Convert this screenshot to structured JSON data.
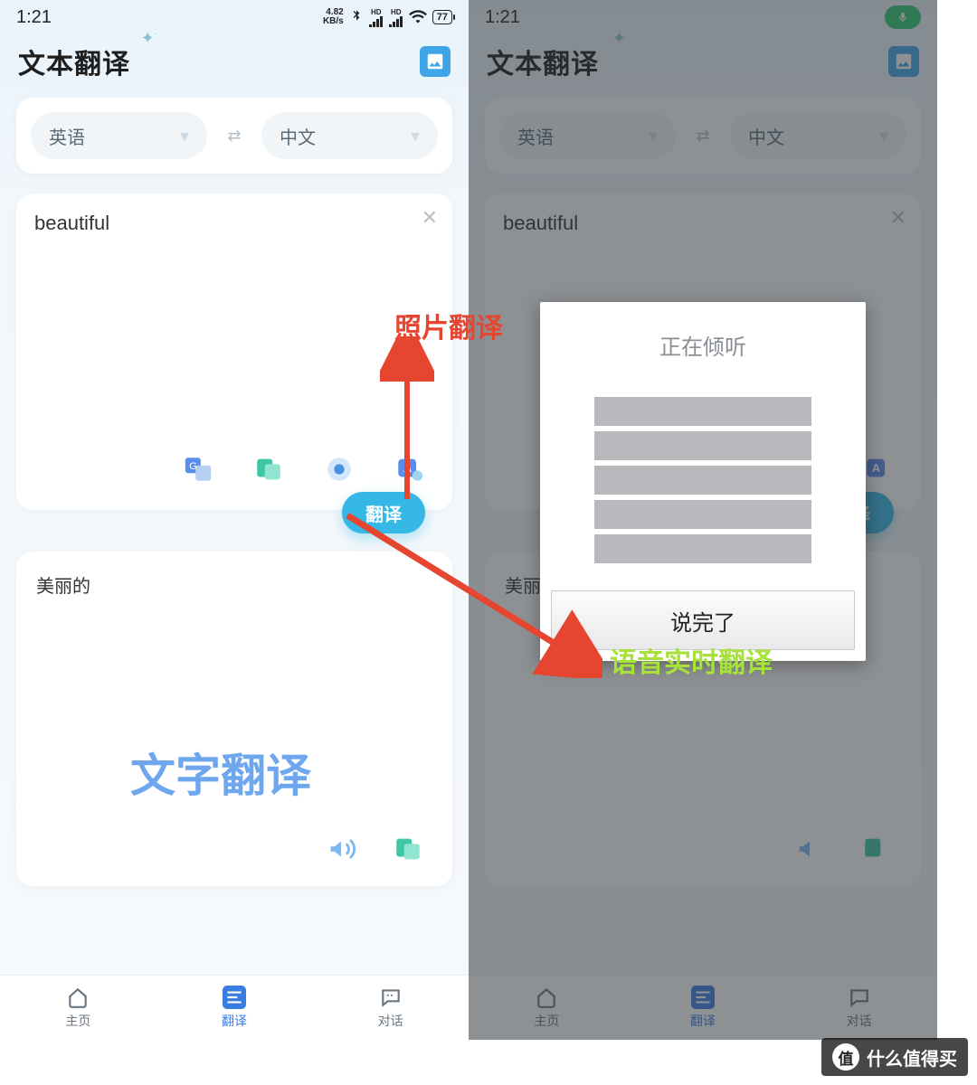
{
  "status": {
    "time": "1:21",
    "speed_value": "4.82",
    "speed_unit": "KB/s",
    "hd": "HD",
    "battery": "77"
  },
  "header": {
    "title": "文本翻译"
  },
  "langs": {
    "source": "英语",
    "target": "中文"
  },
  "input": {
    "text": "beautiful"
  },
  "translate_button": "翻译",
  "result": {
    "text": "美丽的"
  },
  "tabs": {
    "home": "主页",
    "translate": "翻译",
    "dialog": "对话"
  },
  "annotations": {
    "photo": "照片翻译",
    "text": "文字翻译",
    "voice": "语音实时翻译"
  },
  "listening_dialog": {
    "title": "正在倾听",
    "done": "说完了"
  },
  "corner_tag": {
    "badge": "值",
    "text": "什么值得买"
  }
}
